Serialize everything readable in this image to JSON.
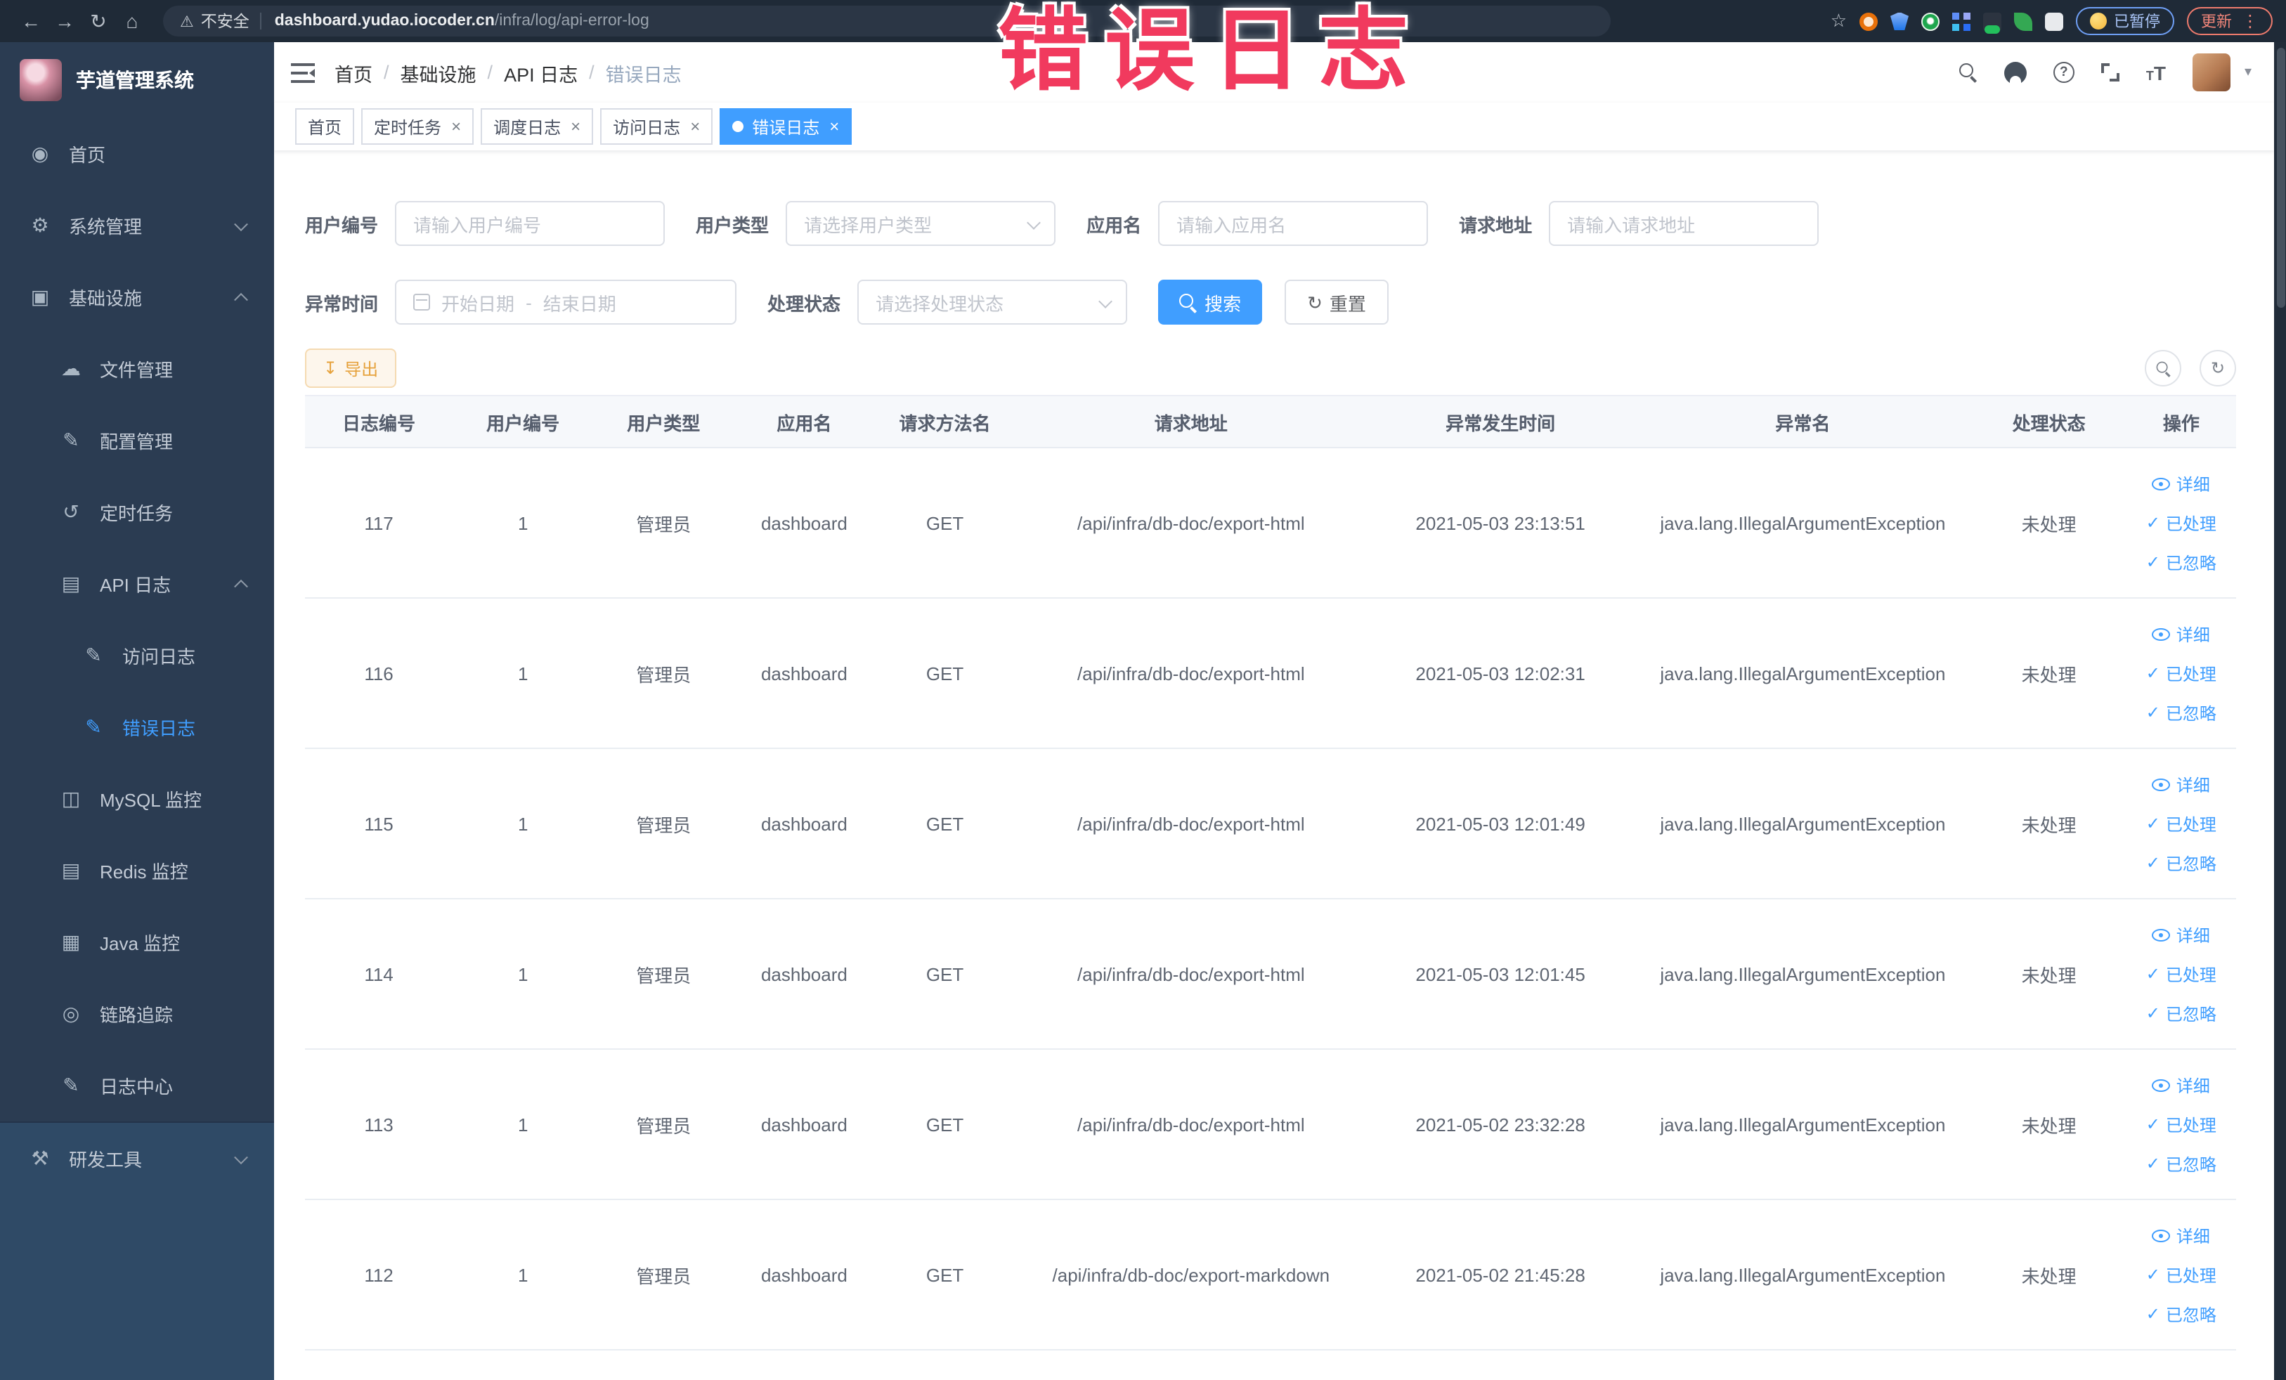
{
  "browser": {
    "security_label": "不安全",
    "url_domain": "dashboard.yudao.iocoder.cn",
    "url_path": "/infra/log/api-error-log",
    "paused_badge": "已暂停",
    "update_label": "更新"
  },
  "watermark": "错误日志",
  "icons": {
    "back": "←",
    "forward": "→",
    "reload": "↻",
    "home_browser": "⌂",
    "warning": "⚠",
    "star": "☆",
    "dots": "⋮",
    "caret": "▾",
    "home": "◉",
    "settings": "⚙",
    "infra": "▣",
    "file": "☁",
    "config": "✎",
    "cron": "↺",
    "apilog": "▤",
    "accesslog": "✎",
    "errorlog": "✎",
    "mysql": "◫",
    "redis": "▤",
    "java": "▦",
    "trace": "◎",
    "logcenter": "✎",
    "devtools": "⚒",
    "download": "↧",
    "refresh": "↻",
    "check": "✓",
    "close": "×"
  },
  "sidebar": {
    "title": "芋道管理系统",
    "items": [
      {
        "label": "首页"
      },
      {
        "label": "系统管理"
      },
      {
        "label": "基础设施"
      },
      {
        "label": "文件管理"
      },
      {
        "label": "配置管理"
      },
      {
        "label": "定时任务"
      },
      {
        "label": "API 日志"
      },
      {
        "label": "访问日志"
      },
      {
        "label": "错误日志"
      },
      {
        "label": "MySQL 监控"
      },
      {
        "label": "Redis 监控"
      },
      {
        "label": "Java 监控"
      },
      {
        "label": "链路追踪"
      },
      {
        "label": "日志中心"
      },
      {
        "label": "研发工具"
      }
    ]
  },
  "header": {
    "breadcrumb": [
      "首页",
      "基础设施",
      "API 日志",
      "错误日志"
    ],
    "breadcrumb_separator": "/"
  },
  "tabs": [
    {
      "label": "首页"
    },
    {
      "label": "定时任务"
    },
    {
      "label": "调度日志"
    },
    {
      "label": "访问日志"
    },
    {
      "label": "错误日志"
    }
  ],
  "filters": {
    "user_id_label": "用户编号",
    "user_id_placeholder": "请输入用户编号",
    "user_type_label": "用户类型",
    "user_type_placeholder": "请选择用户类型",
    "app_name_label": "应用名",
    "app_name_placeholder": "请输入应用名",
    "request_url_label": "请求地址",
    "request_url_placeholder": "请输入请求地址",
    "exception_time_label": "异常时间",
    "date_start_placeholder": "开始日期",
    "date_separator": "-",
    "date_end_placeholder": "结束日期",
    "process_status_label": "处理状态",
    "process_status_placeholder": "请选择处理状态",
    "search_label": "搜索",
    "reset_label": "重置"
  },
  "toolbar": {
    "export_label": "导出"
  },
  "table": {
    "columns": [
      "日志编号",
      "用户编号",
      "用户类型",
      "应用名",
      "请求方法名",
      "请求地址",
      "异常发生时间",
      "异常名",
      "处理状态",
      "操作"
    ],
    "actions": [
      "详细",
      "已处理",
      "已忽略"
    ],
    "rows": [
      {
        "cells": [
          "117",
          "1",
          "管理员",
          "dashboard",
          "GET",
          "/api/infra/db-doc/export-html",
          "2021-05-03 23:13:51",
          "java.lang.IllegalArgumentException",
          "未处理"
        ]
      },
      {
        "cells": [
          "116",
          "1",
          "管理员",
          "dashboard",
          "GET",
          "/api/infra/db-doc/export-html",
          "2021-05-03 12:02:31",
          "java.lang.IllegalArgumentException",
          "未处理"
        ]
      },
      {
        "cells": [
          "115",
          "1",
          "管理员",
          "dashboard",
          "GET",
          "/api/infra/db-doc/export-html",
          "2021-05-03 12:01:49",
          "java.lang.IllegalArgumentException",
          "未处理"
        ]
      },
      {
        "cells": [
          "114",
          "1",
          "管理员",
          "dashboard",
          "GET",
          "/api/infra/db-doc/export-html",
          "2021-05-03 12:01:45",
          "java.lang.IllegalArgumentException",
          "未处理"
        ]
      },
      {
        "cells": [
          "113",
          "1",
          "管理员",
          "dashboard",
          "GET",
          "/api/infra/db-doc/export-html",
          "2021-05-02 23:32:28",
          "java.lang.IllegalArgumentException",
          "未处理"
        ]
      },
      {
        "cells": [
          "112",
          "1",
          "管理员",
          "dashboard",
          "GET",
          "/api/infra/db-doc/export-markdown",
          "2021-05-02 21:45:28",
          "java.lang.IllegalArgumentException",
          "未处理"
        ]
      }
    ]
  }
}
